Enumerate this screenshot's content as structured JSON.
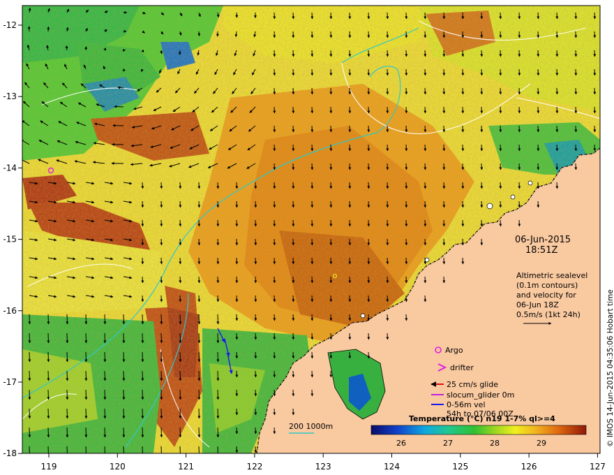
{
  "map": {
    "date": "06-Jun-2015",
    "time": "18:51Z",
    "altimetry_lines": [
      "Altimetric sealevel",
      "(0.1m contours)",
      "and velocity for",
      "06-Jun 18Z",
      "0.5m/s (1kt 24h)"
    ],
    "credit": "© IMOS 14-Jun-2015 04:35:06 Hobart time",
    "lon_ticks": [
      "119",
      "120",
      "121",
      "122",
      "123",
      "124",
      "125",
      "126",
      "127"
    ],
    "lat_ticks": [
      "-12",
      "-13",
      "-14",
      "-15",
      "-16",
      "-17",
      "-18"
    ],
    "legend": {
      "argo": "Argo",
      "drifter": "drifter",
      "glide": "25 cm/s glide",
      "slocum": "slocum_glider 0m",
      "vel": "0-56m vel",
      "vel_range": "54h to 07/06 00Z",
      "bathy": "200  1000m"
    },
    "colorbar": {
      "title": "Temperature (°C) n19 1-7% ql>=4",
      "ticks": [
        "26",
        "27",
        "28",
        "29"
      ]
    },
    "colors": {
      "land": "#f9c9a0",
      "argo": "#e020e0",
      "drifter": "#e020e0",
      "glide": "#e01010",
      "slocum": "#c020e0",
      "vel": "#1a1aee",
      "bathy": "#30c8c8"
    }
  }
}
